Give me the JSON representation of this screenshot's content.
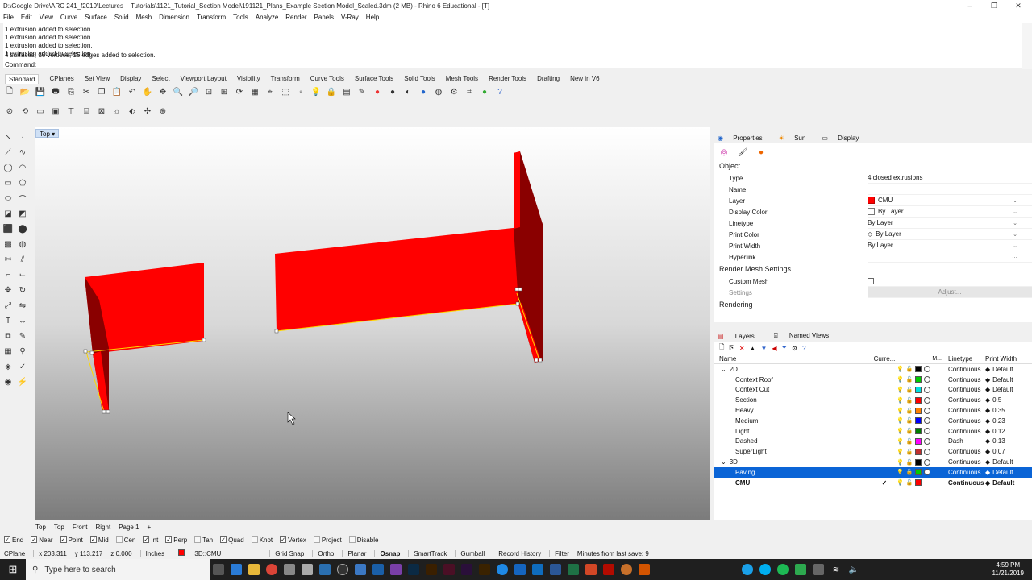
{
  "window": {
    "title": "D:\\Google Drive\\ARC 241_f2019\\Lectures + Tutorials\\1121_Tutorial_Section Model\\191121_Plans_Example Section Model_Scaled.3dm (2 MB) - Rhino 6 Educational - [T]"
  },
  "menu": [
    "File",
    "Edit",
    "View",
    "Curve",
    "Surface",
    "Solid",
    "Mesh",
    "Dimension",
    "Transform",
    "Tools",
    "Analyze",
    "Render",
    "Panels",
    "V-Ray",
    "Help"
  ],
  "command": {
    "history": [
      "1 extrusion added to selection.",
      "1 extrusion added to selection.",
      "1 extrusion added to selection.",
      "1 extrusion added to selection.",
      "4 surfaces, 16 vertices, 16 edges added to selection."
    ],
    "prompt": "Command:",
    "value": ""
  },
  "toolbar_tabs": [
    "Standard",
    "CPlanes",
    "Set View",
    "Display",
    "Select",
    "Viewport Layout",
    "Visibility",
    "Transform",
    "Curve Tools",
    "Surface Tools",
    "Solid Tools",
    "Mesh Tools",
    "Render Tools",
    "Drafting",
    "New in V6"
  ],
  "viewport": {
    "label": "Top",
    "tabs": [
      "Top",
      "Top",
      "Front",
      "Right",
      "Page 1",
      "+"
    ],
    "object_color": "#ff0000"
  },
  "properties": {
    "tabs": [
      "Properties",
      "Sun",
      "Display"
    ],
    "section_object": "Object",
    "rows": [
      {
        "k": "Type",
        "v": "4 closed extrusions"
      },
      {
        "k": "Name",
        "v": ""
      },
      {
        "k": "Layer",
        "v": "CMU"
      },
      {
        "k": "Display Color",
        "v": "By Layer"
      },
      {
        "k": "Linetype",
        "v": "By Layer"
      },
      {
        "k": "Print Color",
        "v": "By Layer"
      },
      {
        "k": "Print Width",
        "v": "By Layer"
      },
      {
        "k": "Hyperlink",
        "v": ""
      }
    ],
    "section_mesh": "Render Mesh Settings",
    "custom_mesh": "Custom Mesh",
    "settings": "Settings",
    "adjust": "Adjust...",
    "section_render": "Rendering"
  },
  "layers": {
    "tabs": [
      "Layers",
      "Named Views"
    ],
    "headers": {
      "name": "Name",
      "current": "Curre...",
      "m": "M...",
      "linetype": "Linetype",
      "width": "Print Width"
    },
    "rows": [
      {
        "name": "2D",
        "indent": 0,
        "expand": "⌄",
        "color": "#000000",
        "linetype": "Continuous",
        "width": "Default"
      },
      {
        "name": "Context Roof",
        "indent": 1,
        "color": "#00cc00",
        "linetype": "Continuous",
        "width": "Default"
      },
      {
        "name": "Context Cut",
        "indent": 1,
        "color": "#00e0e0",
        "linetype": "Continuous",
        "width": "Default"
      },
      {
        "name": "Section",
        "indent": 1,
        "color": "#ff0000",
        "linetype": "Continuous",
        "width": "0.5"
      },
      {
        "name": "Heavy",
        "indent": 1,
        "color": "#ff8000",
        "linetype": "Continuous",
        "width": "0.35"
      },
      {
        "name": "Medium",
        "indent": 1,
        "color": "#0000ff",
        "linetype": "Continuous",
        "width": "0.23"
      },
      {
        "name": "Light",
        "indent": 1,
        "color": "#008000",
        "linetype": "Continuous",
        "width": "0.12"
      },
      {
        "name": "Dashed",
        "indent": 1,
        "color": "#ff00ff",
        "linetype": "Dash",
        "width": "0.13"
      },
      {
        "name": "SuperLight",
        "indent": 1,
        "color": "#c03030",
        "linetype": "Continuous",
        "width": "0.07"
      },
      {
        "name": "3D",
        "indent": 0,
        "expand": "⌄",
        "color": "#000000",
        "linetype": "Continuous",
        "width": "Default"
      },
      {
        "name": "Paving",
        "indent": 1,
        "color": "#00cc00",
        "linetype": "Continuous",
        "width": "Default",
        "selected": true
      },
      {
        "name": "CMU",
        "indent": 1,
        "color": "#ff0000",
        "linetype": "Continuous",
        "width": "Default",
        "current": true
      }
    ]
  },
  "osnap": [
    {
      "label": "End",
      "on": true
    },
    {
      "label": "Near",
      "on": true
    },
    {
      "label": "Point",
      "on": true
    },
    {
      "label": "Mid",
      "on": true
    },
    {
      "label": "Cen",
      "on": false
    },
    {
      "label": "Int",
      "on": true
    },
    {
      "label": "Perp",
      "on": true
    },
    {
      "label": "Tan",
      "on": false
    },
    {
      "label": "Quad",
      "on": true
    },
    {
      "label": "Knot",
      "on": false
    },
    {
      "label": "Vertex",
      "on": true
    },
    {
      "label": "Project",
      "on": false
    },
    {
      "label": "Disable",
      "on": false
    }
  ],
  "status": {
    "cplane": "CPlane",
    "x": "x 203.311",
    "y": "y 113.217",
    "z": "z 0.000",
    "units": "Inches",
    "layer": "3D::CMU",
    "toggles": [
      "Grid Snap",
      "Ortho",
      "Planar",
      "Osnap",
      "SmartTrack",
      "Gumball",
      "Record History",
      "Filter"
    ],
    "save": "Minutes from last save: 9"
  },
  "taskbar": {
    "search_placeholder": "Type here to search",
    "time": "4:59 PM",
    "date": "11/21/2019"
  }
}
